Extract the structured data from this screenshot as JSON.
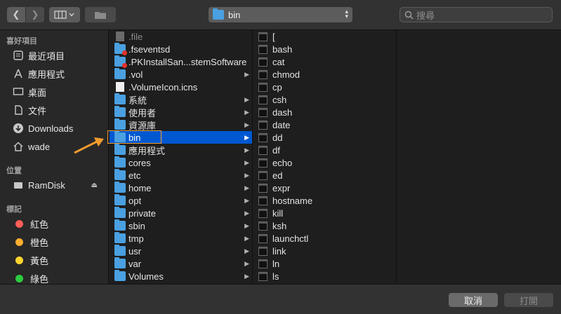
{
  "toolbar": {
    "back_icon": "chevron-left",
    "forward_icon": "chevron-right",
    "path_label": "bin",
    "search_placeholder": "搜尋"
  },
  "sidebar": {
    "favorites_title": "喜好項目",
    "favorites": [
      {
        "label": "最近項目",
        "icon": "clock-icon"
      },
      {
        "label": "應用程式",
        "icon": "apps-icon"
      },
      {
        "label": "桌面",
        "icon": "desktop-icon"
      },
      {
        "label": "文件",
        "icon": "document-icon"
      },
      {
        "label": "Downloads",
        "icon": "download-icon"
      },
      {
        "label": "wade",
        "icon": "home-icon"
      }
    ],
    "locations_title": "位置",
    "locations": [
      {
        "label": "RamDisk",
        "icon": "drive-icon"
      }
    ],
    "tags_title": "標記",
    "tags": [
      {
        "label": "紅色",
        "color": "#ff5f57"
      },
      {
        "label": "橙色",
        "color": "#ffae2f"
      },
      {
        "label": "黃色",
        "color": "#ffd52e"
      },
      {
        "label": "綠色",
        "color": "#2ecc40"
      }
    ]
  },
  "column1": [
    {
      "name": ".file",
      "kind": "doc-dim",
      "dim": true,
      "chevron": false
    },
    {
      "name": ".fseventsd",
      "kind": "folder-badge",
      "chevron": false
    },
    {
      "name": ".PKInstallSan...stemSoftware",
      "kind": "folder-badge",
      "chevron": false
    },
    {
      "name": ".vol",
      "kind": "folder",
      "chevron": true
    },
    {
      "name": ".VolumeIcon.icns",
      "kind": "doc",
      "chevron": false
    },
    {
      "name": "系統",
      "kind": "folder",
      "chevron": true
    },
    {
      "name": "使用者",
      "kind": "folder",
      "chevron": true
    },
    {
      "name": "資源庫",
      "kind": "folder",
      "chevron": true
    },
    {
      "name": "bin",
      "kind": "folder",
      "chevron": true,
      "selected": true
    },
    {
      "name": "應用程式",
      "kind": "folder",
      "chevron": true
    },
    {
      "name": "cores",
      "kind": "folder",
      "chevron": true
    },
    {
      "name": "etc",
      "kind": "folder",
      "chevron": true
    },
    {
      "name": "home",
      "kind": "folder",
      "chevron": true
    },
    {
      "name": "opt",
      "kind": "folder",
      "chevron": true
    },
    {
      "name": "private",
      "kind": "folder",
      "chevron": true
    },
    {
      "name": "sbin",
      "kind": "folder",
      "chevron": true
    },
    {
      "name": "tmp",
      "kind": "folder",
      "chevron": true
    },
    {
      "name": "usr",
      "kind": "folder",
      "chevron": true
    },
    {
      "name": "var",
      "kind": "folder",
      "chevron": true
    },
    {
      "name": "Volumes",
      "kind": "folder",
      "chevron": true
    }
  ],
  "column2": [
    "[",
    "bash",
    "cat",
    "chmod",
    "cp",
    "csh",
    "dash",
    "date",
    "dd",
    "df",
    "echo",
    "ed",
    "expr",
    "hostname",
    "kill",
    "ksh",
    "launchctl",
    "link",
    "ln",
    "ls"
  ],
  "bottom": {
    "cancel_label": "取消",
    "open_label": "打開"
  },
  "annotation_color": "#f39c2e"
}
